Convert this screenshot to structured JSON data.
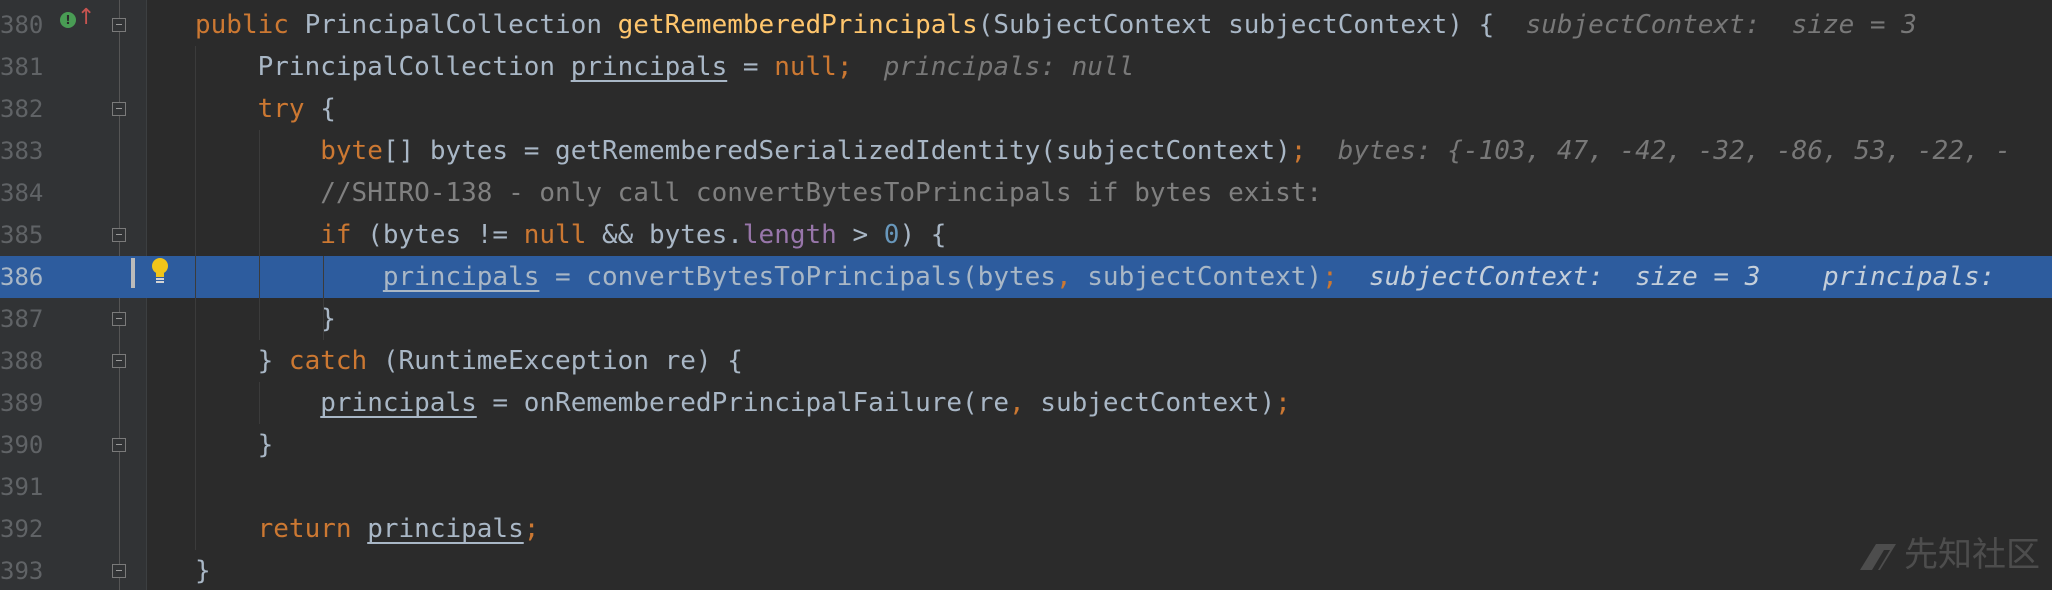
{
  "editor": {
    "lines": [
      {
        "number": "380",
        "tokens": [
          {
            "text": "public ",
            "cls": "kw"
          },
          {
            "text": "PrincipalCollection ",
            "cls": ""
          },
          {
            "text": "getRememberedPrincipals",
            "cls": "fn"
          },
          {
            "text": "(SubjectContext subjectContext) {",
            "cls": ""
          }
        ],
        "inlay": "subjectContext:  size = 3"
      },
      {
        "number": "381",
        "tokens": [
          {
            "text": "    PrincipalCollection ",
            "cls": ""
          },
          {
            "text": "principals",
            "cls": "var-u"
          },
          {
            "text": " = ",
            "cls": ""
          },
          {
            "text": "null",
            "cls": "kw"
          },
          {
            "text": ";",
            "cls": "kw"
          }
        ],
        "inlay": "principals: null"
      },
      {
        "number": "382",
        "tokens": [
          {
            "text": "    ",
            "cls": ""
          },
          {
            "text": "try",
            "cls": "kw"
          },
          {
            "text": " {",
            "cls": ""
          }
        ],
        "inlay": ""
      },
      {
        "number": "383",
        "tokens": [
          {
            "text": "        ",
            "cls": ""
          },
          {
            "text": "byte",
            "cls": "kw"
          },
          {
            "text": "[] bytes = getRememberedSerializedIdentity(subjectContext)",
            "cls": ""
          },
          {
            "text": ";",
            "cls": "kw"
          }
        ],
        "inlay": "bytes: {-103, 47, -42, -32, -86, 53, -22, -"
      },
      {
        "number": "384",
        "tokens": [
          {
            "text": "        ",
            "cls": ""
          },
          {
            "text": "//SHIRO-138 - only call convertBytesToPrincipals if bytes exist:",
            "cls": "cmt"
          }
        ],
        "inlay": ""
      },
      {
        "number": "385",
        "tokens": [
          {
            "text": "        ",
            "cls": ""
          },
          {
            "text": "if",
            "cls": "kw"
          },
          {
            "text": " (bytes != ",
            "cls": ""
          },
          {
            "text": "null",
            "cls": "kw"
          },
          {
            "text": " && bytes.",
            "cls": ""
          },
          {
            "text": "length",
            "cls": "field"
          },
          {
            "text": " > ",
            "cls": ""
          },
          {
            "text": "0",
            "cls": "num"
          },
          {
            "text": ") {",
            "cls": ""
          }
        ],
        "inlay": ""
      },
      {
        "number": "386",
        "exec": true,
        "tokens": [
          {
            "text": "            ",
            "cls": ""
          },
          {
            "text": "principals",
            "cls": "var-u"
          },
          {
            "text": " = convertBytesToPrincipals(bytes",
            "cls": ""
          },
          {
            "text": ",",
            "cls": "kw"
          },
          {
            "text": " subjectContext)",
            "cls": ""
          },
          {
            "text": ";",
            "cls": "kw"
          }
        ],
        "inlay": "subjectContext:  size = 3    principals: "
      },
      {
        "number": "387",
        "tokens": [
          {
            "text": "        }",
            "cls": ""
          }
        ],
        "inlay": ""
      },
      {
        "number": "388",
        "tokens": [
          {
            "text": "    } ",
            "cls": ""
          },
          {
            "text": "catch",
            "cls": "kw"
          },
          {
            "text": " (RuntimeException re) {",
            "cls": ""
          }
        ],
        "inlay": ""
      },
      {
        "number": "389",
        "tokens": [
          {
            "text": "        ",
            "cls": ""
          },
          {
            "text": "principals",
            "cls": "var-u"
          },
          {
            "text": " = onRememberedPrincipalFailure(re",
            "cls": ""
          },
          {
            "text": ",",
            "cls": "kw"
          },
          {
            "text": " subjectContext)",
            "cls": ""
          },
          {
            "text": ";",
            "cls": "kw"
          }
        ],
        "inlay": ""
      },
      {
        "number": "390",
        "tokens": [
          {
            "text": "    }",
            "cls": ""
          }
        ],
        "inlay": ""
      },
      {
        "number": "391",
        "tokens": [],
        "inlay": ""
      },
      {
        "number": "392",
        "tokens": [
          {
            "text": "    ",
            "cls": ""
          },
          {
            "text": "return",
            "cls": "kw"
          },
          {
            "text": " ",
            "cls": ""
          },
          {
            "text": "principals",
            "cls": "var-u"
          },
          {
            "text": ";",
            "cls": "kw"
          }
        ],
        "inlay": ""
      },
      {
        "number": "393",
        "tokens": [
          {
            "text": "}",
            "cls": ""
          }
        ],
        "inlay": ""
      }
    ]
  },
  "gutter": {
    "override_icon": "override-implementing-icon",
    "override_glyph": "!",
    "up_arrow_glyph": "↑",
    "bulb_icon": "lightbulb-icon",
    "fold_lines": [
      "380",
      "382",
      "385",
      "387",
      "388",
      "390",
      "393"
    ]
  },
  "watermark": {
    "text": "先知社区"
  },
  "colors": {
    "background": "#2b2b2b",
    "gutter": "#313335",
    "execution_line": "#2d5c9e",
    "keyword": "#cc7832",
    "method": "#ffc66d",
    "number": "#6897bb",
    "field": "#9876aa",
    "comment": "#808080",
    "inlay_hint": "#787878"
  }
}
